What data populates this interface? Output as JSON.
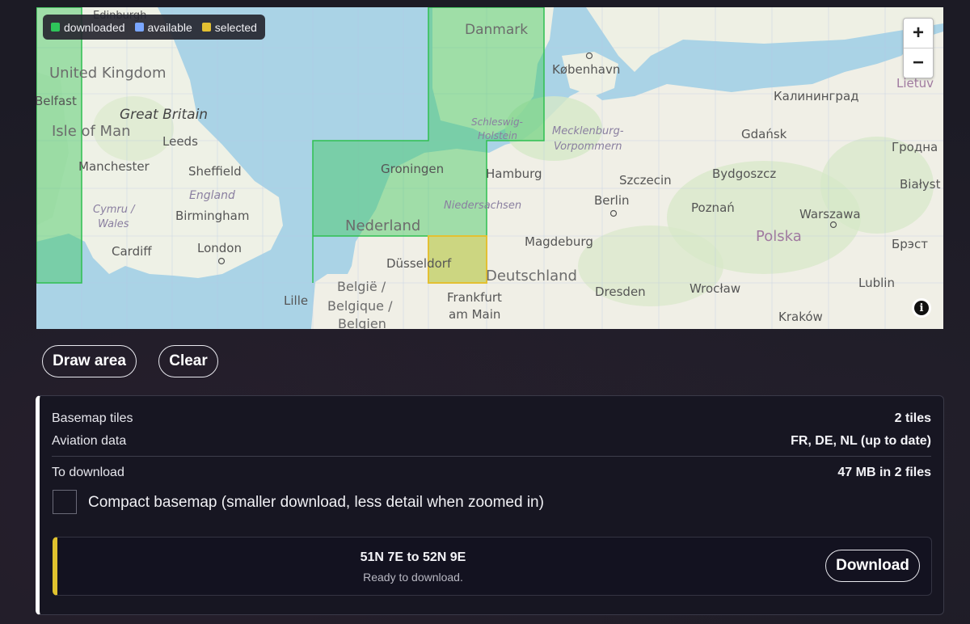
{
  "legend": {
    "items": [
      {
        "label": "downloaded",
        "color": "#2ec55a"
      },
      {
        "label": "available",
        "color": "#7aa6ff"
      },
      {
        "label": "selected",
        "color": "#e3c032"
      }
    ]
  },
  "map": {
    "zoom_in": "+",
    "zoom_out": "−",
    "info": "i",
    "labels": {
      "edinburgh": "Edinburgh",
      "uk": "United Kingdom",
      "belfast": "Belfast",
      "great_britain": "Great Britain",
      "isle_of_man": "Isle of Man",
      "leeds": "Leeds",
      "manchester": "Manchester",
      "sheffield": "Sheffield",
      "england": "England",
      "cymru": "Cymru /",
      "wales": "Wales",
      "birmingham": "Birmingham",
      "cardiff": "Cardiff",
      "london": "London",
      "danmark": "Danmark",
      "kobenhavn": "København",
      "schleswig": "Schleswig-",
      "holstein": "Holstein",
      "mecklenburg": "Mecklenburg-",
      "vorpommern": "Vorpommern",
      "groningen": "Groningen",
      "hamburg": "Hamburg",
      "niedersachsen": "Niedersachsen",
      "nederland": "Nederland",
      "magdeburg": "Magdeburg",
      "dusseldorf": "Düsseldorf",
      "deutschland": "Deutschland",
      "belgie": "België /",
      "belgique": "Belgique /",
      "belgien": "Belgien",
      "lille": "Lille",
      "frankfurt": "Frankfurt",
      "am_main": "am Main",
      "szczecin": "Szczecin",
      "berlin": "Berlin",
      "bydgoszcz": "Bydgoszcz",
      "gdansk": "Gdańsk",
      "kaliningrad": "Калининград",
      "poznan": "Poznań",
      "warszawa": "Warszawa",
      "polska": "Polska",
      "dresden": "Dresden",
      "wroclaw": "Wrocław",
      "lublin": "Lublin",
      "krakow": "Kraków",
      "brest": "Брэст",
      "bialystok": "Białyst",
      "grodno": "Гродна",
      "lietuva": "Lietuv"
    }
  },
  "actions": {
    "draw_area": "Draw area",
    "clear": "Clear"
  },
  "summary": {
    "basemap_label": "Basemap tiles",
    "basemap_value": "2 tiles",
    "aviation_label": "Aviation data",
    "aviation_value": "FR, DE, NL (up to date)",
    "download_label": "To download",
    "download_value": "47 MB in 2 files",
    "compact_label": "Compact basemap (smaller download, less detail when zoomed in)",
    "compact_checked": false
  },
  "job": {
    "title": "51N 7E to 52N 9E",
    "status": "Ready to download.",
    "accent": "#e0c22e",
    "button": "Download"
  }
}
